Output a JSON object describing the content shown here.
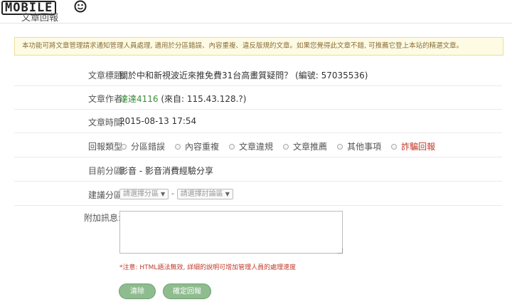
{
  "brand": {
    "logo_text": "MOBILE",
    "logo_icon": "smiley-icon"
  },
  "page": {
    "title": "文章回報"
  },
  "notice": "本功能可將文章管理請求通知管理人員處理, 適用於分區錯誤、內容重複、違反版規的文章。如果您覺得此文章不錯, 可推薦它登上本站的精選文章。",
  "fields": {
    "title": {
      "label": "文章標題:",
      "value": "關於中和新視波近來推免費31台高畫質疑問？ (編號: 57035536)"
    },
    "author": {
      "label": "文章作者:",
      "name": "達達4116",
      "from": "(來自: 115.43.128.?)"
    },
    "time": {
      "label": "文章時間:",
      "value": "2015-08-13 17:54"
    },
    "type": {
      "label": "回報類型:",
      "options": [
        "分區錯誤",
        "內容重複",
        "文章違規",
        "文章推薦",
        "其他事項",
        "詐騙回報"
      ]
    },
    "current": {
      "label": "目前分區:",
      "value": "影音 - 影音消費經驗分享"
    },
    "suggest": {
      "label": "建議分區:",
      "select1": "請選擇分區",
      "separator": "-",
      "select2": "請選擇討論區"
    },
    "message": {
      "label": "附加訊息:",
      "value": ""
    }
  },
  "note": "*注意: HTML語法無效, 詳細的說明可增加管理人員的處理速度",
  "buttons": {
    "clear": "清除",
    "submit": "確定回報"
  }
}
